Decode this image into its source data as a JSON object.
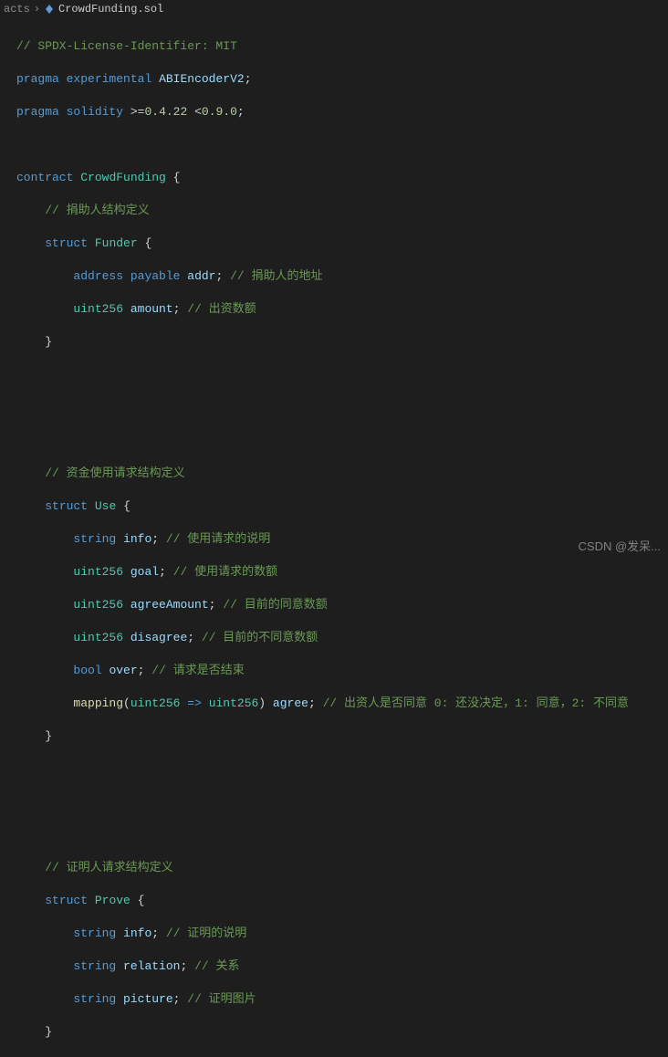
{
  "breadcrumb": {
    "folder": "acts",
    "file": "CrowdFunding.sol"
  },
  "code": {
    "l1_comment": "// SPDX-License-Identifier: MIT",
    "l2": {
      "kw1": "pragma",
      "kw2": "experimental",
      "id": "ABIEncoderV2",
      "semi": ";"
    },
    "l3": {
      "kw1": "pragma",
      "kw2": "solidity",
      "op1": ">=",
      "v1a": "0.4",
      "v1b": ".22",
      "op2": "<",
      "v2a": "0.9",
      "v2b": ".0",
      "semi": ";"
    },
    "l5": {
      "kw": "contract",
      "name": "CrowdFunding",
      "brace": "{"
    },
    "l6_comment": "// 捐助人结构定义",
    "l7": {
      "kw": "struct",
      "name": "Funder",
      "brace": "{"
    },
    "l8": {
      "t1": "address",
      "t2": "payable",
      "id": "addr",
      "semi": ";",
      "comment": "// 捐助人的地址"
    },
    "l9": {
      "t": "uint256",
      "id": "amount",
      "semi": ";",
      "comment": "// 出资数额"
    },
    "l10_brace": "}",
    "l14_comment": "// 资金使用请求结构定义",
    "l15": {
      "kw": "struct",
      "name": "Use",
      "brace": "{"
    },
    "l16": {
      "t": "string",
      "id": "info",
      "semi": ";",
      "comment": "// 使用请求的说明"
    },
    "l17": {
      "t": "uint256",
      "id": "goal",
      "semi": ";",
      "comment": "// 使用请求的数额"
    },
    "l18": {
      "t": "uint256",
      "id": "agreeAmount",
      "semi": ";",
      "comment": "// 目前的同意数额"
    },
    "l19": {
      "t": "uint256",
      "id": "disagree",
      "semi": ";",
      "comment": "// 目前的不同意数额"
    },
    "l20": {
      "t": "bool",
      "id": "over",
      "semi": ";",
      "comment": "// 请求是否结束"
    },
    "l21": {
      "kw": "mapping",
      "lp": "(",
      "t1": "uint256",
      "arrow": "=>",
      "t2": "uint256",
      "rp": ")",
      "id": "agree",
      "semi": ";",
      "comment": "// 出资人是否同意 0: 还没决定，1: 同意，2: 不同意"
    },
    "l22_brace": "}",
    "l26_comment": "// 证明人请求结构定义",
    "l27": {
      "kw": "struct",
      "name": "Prove",
      "brace": "{"
    },
    "l28": {
      "t": "string",
      "id": "info",
      "semi": ";",
      "comment": "// 证明的说明"
    },
    "l29": {
      "t": "string",
      "id": "relation",
      "semi": ";",
      "comment": "// 关系"
    },
    "l30": {
      "t": "string",
      "id": "picture",
      "semi": ";",
      "comment": "// 证明图片"
    },
    "l31_brace": "}"
  },
  "watermark": "CSDN @发呆..."
}
